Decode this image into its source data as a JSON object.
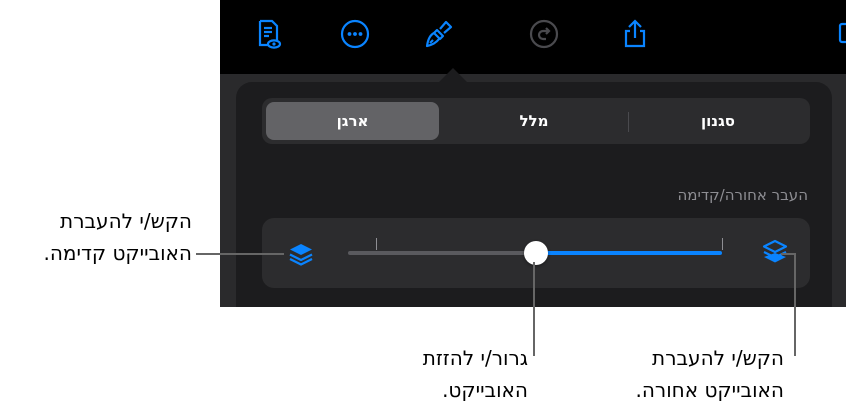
{
  "toolbar": {
    "icons": [
      "reader-view-icon",
      "more-icon",
      "format-brush-icon",
      "redo-icon",
      "share-icon"
    ]
  },
  "segmented_control": {
    "options": [
      "סגנון",
      "מלל",
      "ארגן"
    ],
    "selected": "ארגן"
  },
  "arrange": {
    "section_label": "העבר אחורה/קדימה",
    "slider_position": 0.5
  },
  "callouts": {
    "bring_forward": [
      "הקש/י להעברת",
      "האובייקט קדימה."
    ],
    "move_object": [
      "גרור/י להזזת",
      "האובייקט."
    ],
    "send_backward": [
      "הקש/י להעברת",
      "האובייקט אחורה."
    ]
  },
  "colors": {
    "accent": "#0a84ff",
    "toolbar_bg": "#000000",
    "popover_bg": "#1c1c1e"
  }
}
